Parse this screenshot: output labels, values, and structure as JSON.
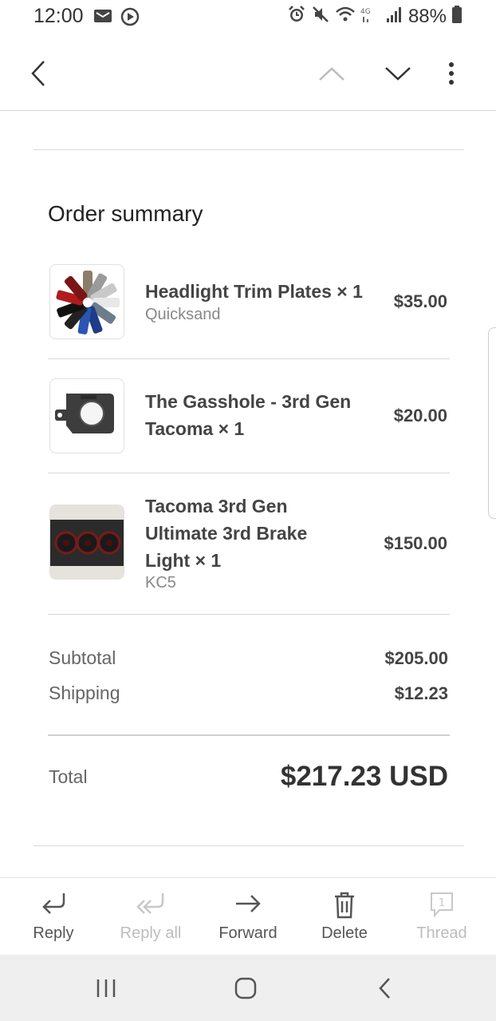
{
  "status_bar": {
    "time": "12:00",
    "battery": "88%",
    "left_icons": [
      "mail-icon",
      "circle-play-icon"
    ],
    "right_icons": [
      "alarm-icon",
      "mute-icon",
      "wifi-icon",
      "lte-icon",
      "signal-icon",
      "battery-icon"
    ]
  },
  "toolbar": {
    "icons": [
      "back-arrow-icon",
      "chevron-up-icon",
      "chevron-down-icon",
      "more-vertical-icon"
    ]
  },
  "order": {
    "title": "Order summary",
    "items": [
      {
        "name_lines": [
          "Headlight Trim Plates × 1"
        ],
        "variant": "Quicksand",
        "price": "$35.00",
        "thumb": "headlight-trim-plates-image"
      },
      {
        "name_lines": [
          "The Gasshole - 3rd Gen",
          "Tacoma × 1"
        ],
        "variant": "",
        "price": "$20.00",
        "thumb": "gasshole-image"
      },
      {
        "name_lines": [
          "Tacoma 3rd Gen",
          "Ultimate 3rd Brake",
          "Light × 1"
        ],
        "variant": "KC5",
        "price": "$150.00",
        "thumb": "brake-light-image"
      }
    ],
    "subtotal_label": "Subtotal",
    "subtotal_value": "$205.00",
    "shipping_label": "Shipping",
    "shipping_value": "$12.23",
    "total_label": "Total",
    "total_value": "$217.23 USD"
  },
  "actions": [
    {
      "label": "Reply",
      "icon": "reply-icon",
      "enabled": true
    },
    {
      "label": "Reply all",
      "icon": "reply-all-icon",
      "enabled": false
    },
    {
      "label": "Forward",
      "icon": "forward-icon",
      "enabled": true
    },
    {
      "label": "Delete",
      "icon": "trash-icon",
      "enabled": true
    },
    {
      "label": "Thread",
      "icon": "thread-icon",
      "enabled": false
    }
  ],
  "thread_count": "1",
  "nav_bar": {
    "icons": [
      "recent-apps-icon",
      "home-icon",
      "back-icon"
    ]
  },
  "colors": {
    "text_dark": "#444444",
    "text_muted": "#888888",
    "disabled": "#bdbdbd",
    "divider": "#d9d9d9",
    "nav_bg": "#efefef"
  }
}
